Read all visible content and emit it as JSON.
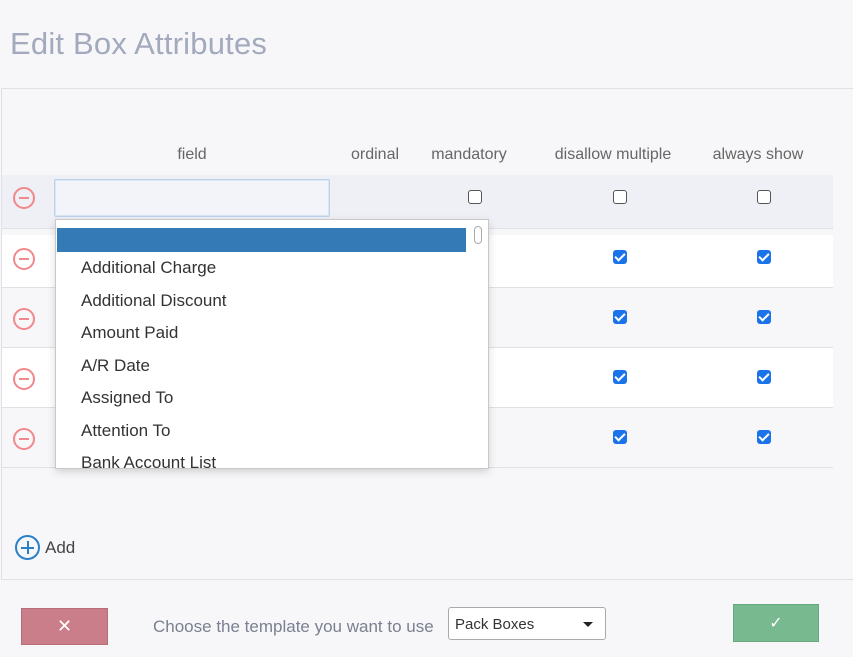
{
  "title": "Edit Box Attributes",
  "columns": {
    "field": "field",
    "ordinal": "ordinal",
    "mandatory": "mandatory",
    "disallow_multiple": "disallow multiple",
    "always_show": "always show"
  },
  "rows": [
    {
      "field": "",
      "mandatory": false,
      "disallow_multiple": false,
      "always_show": false
    },
    {
      "mandatory": null,
      "disallow_multiple": true,
      "always_show": true
    },
    {
      "mandatory": null,
      "disallow_multiple": true,
      "always_show": true
    },
    {
      "mandatory": null,
      "disallow_multiple": true,
      "always_show": true
    },
    {
      "mandatory": null,
      "disallow_multiple": true,
      "always_show": true
    }
  ],
  "dropdown": {
    "selected": "",
    "options": [
      "Additional Charge",
      "Additional Discount",
      "Amount Paid",
      "A/R Date",
      "Assigned To",
      "Attention To",
      "Bank Account List"
    ]
  },
  "add_label": "Add",
  "template": {
    "label": "Choose the template you want to use",
    "value": "Pack Boxes"
  },
  "buttons": {
    "cancel": "✕",
    "ok": "✓"
  },
  "colors": {
    "cancel_bg": "#c97e8a",
    "ok_bg": "#78b990",
    "selected_option": "#337ab7",
    "checkbox_checked": "#1a73e8",
    "remove_icon": "#f0888c",
    "add_icon": "#2a7fc9"
  }
}
